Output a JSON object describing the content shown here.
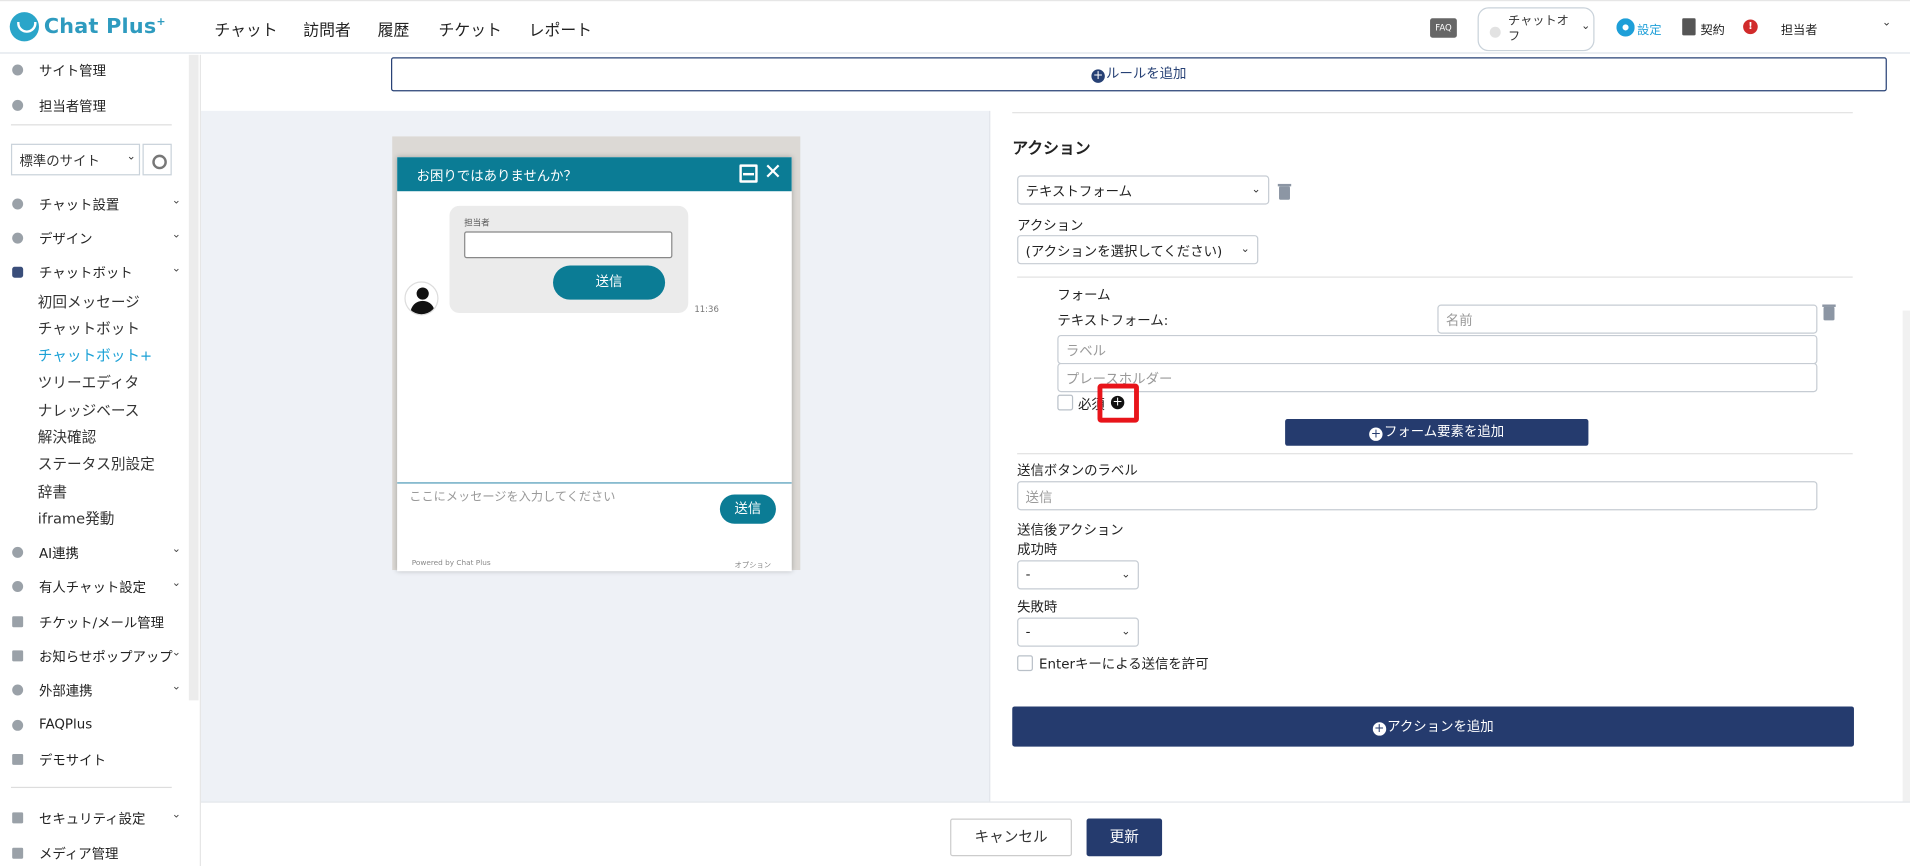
{
  "header": {
    "logo": "Chat Plus",
    "logo_sup": "+",
    "nav": [
      "チャット",
      "訪問者",
      "履歴",
      "チケット",
      "レポート"
    ],
    "faq": "FAQ",
    "status": "チャットオフ",
    "settings": "設定",
    "contract": "契約",
    "alert": "!",
    "user": "担当者"
  },
  "sidebar": {
    "top_items": [
      "サイト管理",
      "担当者管理"
    ],
    "site_select": "標準のサイト",
    "sections": [
      {
        "label": "チャット設置",
        "arrow": "⌄"
      },
      {
        "label": "デザイン",
        "arrow": "⌄"
      },
      {
        "label": "チャットボット",
        "arrow": "⌄"
      }
    ],
    "chatbot_sub": [
      "初回メッセージ",
      "チャットボット",
      "チャットボット+",
      "ツリーエディタ",
      "ナレッジベース",
      "解決確認",
      "ステータス別設定",
      "辞書",
      "iframe発動"
    ],
    "lower_sections": [
      {
        "label": "AI連携",
        "arrow": "⌄"
      },
      {
        "label": "有人チャット設定",
        "arrow": "⌄"
      },
      {
        "label": "チケット/メール管理",
        "arrow": ""
      },
      {
        "label": "お知らせポップアップ",
        "arrow": "⌄"
      },
      {
        "label": "外部連携",
        "arrow": "⌄"
      },
      {
        "label": "FAQPlus",
        "arrow": ""
      },
      {
        "label": "デモサイト",
        "arrow": ""
      }
    ],
    "bottom_sections": [
      {
        "label": "セキュリティ設定",
        "arrow": "⌄"
      },
      {
        "label": "メディア管理",
        "arrow": ""
      }
    ]
  },
  "main": {
    "add_rule": "ルールを追加",
    "preview": {
      "title": "お困りではありませんか？",
      "bubble_label": "担当者",
      "bubble_send": "送信",
      "time": "11:36",
      "input_placeholder": "ここにメッセージを入力してください",
      "send": "送信",
      "powered": "Powered by Chat Plus",
      "option": "オプション"
    },
    "action": {
      "title": "アクション",
      "type_select": "テキストフォーム",
      "action_label": "アクション",
      "action_select": "(アクションを選択してください)",
      "form_title": "フォーム",
      "text_form_label": "テキストフォーム:",
      "name_placeholder": "名前",
      "label_placeholder": "ラベル",
      "placeholder_placeholder": "プレースホルダー",
      "required": "必須",
      "add_form_element": "フォーム要素を追加",
      "send_button_label": "送信ボタンのラベル",
      "send_button_placeholder": "送信",
      "after_send_action": "送信後アクション",
      "success": "成功時",
      "success_value": "-",
      "failure": "失敗時",
      "failure_value": "-",
      "enter_allow": "Enterキーによる送信を許可",
      "add_action": "アクションを追加"
    },
    "cancel": "キャンセル",
    "update": "更新"
  },
  "colors": {
    "navy": "#253b6e",
    "teal": "#0b7c95",
    "accent_blue": "#1ba1d6",
    "highlight_red": "#e8141a"
  }
}
